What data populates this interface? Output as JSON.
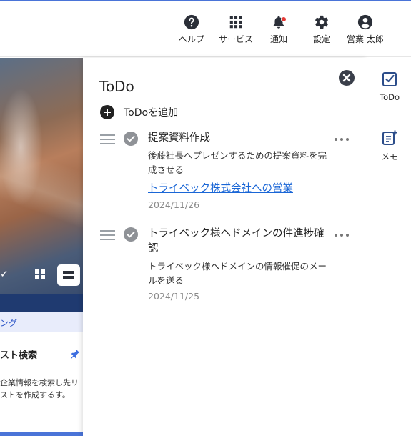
{
  "header": {
    "items": [
      {
        "label": "ヘルプ",
        "icon": "help-icon"
      },
      {
        "label": "サービス",
        "icon": "apps-grid-icon"
      },
      {
        "label": "通知",
        "icon": "bell-icon"
      },
      {
        "label": "設定",
        "icon": "gear-icon"
      },
      {
        "label": "営業 太郎",
        "icon": "user-icon"
      }
    ],
    "accent": "#4a74d8",
    "notification_dot_color": "#e53935"
  },
  "background_page": {
    "tab_label": "ング",
    "card_title": "スト検索",
    "card_text": "企業情報を検索し先リストを作成するす。",
    "view_toggle_check": "✓"
  },
  "todo_panel": {
    "title": "ToDo",
    "add_label": "ToDoを追加",
    "items": [
      {
        "title": "提案資料作成",
        "description": "後藤社長へプレゼンするための提案資料を完成させる",
        "link": "トライベック株式会社への営業",
        "date": "2024/11/26"
      },
      {
        "title": "トライベック様ヘドメインの件進捗確認",
        "description": "トライベック様ヘドメインの情報催促のメールを送る",
        "date": "2024/11/25"
      }
    ]
  },
  "rail": {
    "items": [
      {
        "label": "ToDo",
        "icon": "todo-check-icon"
      },
      {
        "label": "メモ",
        "icon": "memo-icon"
      }
    ]
  },
  "colors": {
    "link": "#1a66d6",
    "rail_icon": "#2c4d8a"
  }
}
